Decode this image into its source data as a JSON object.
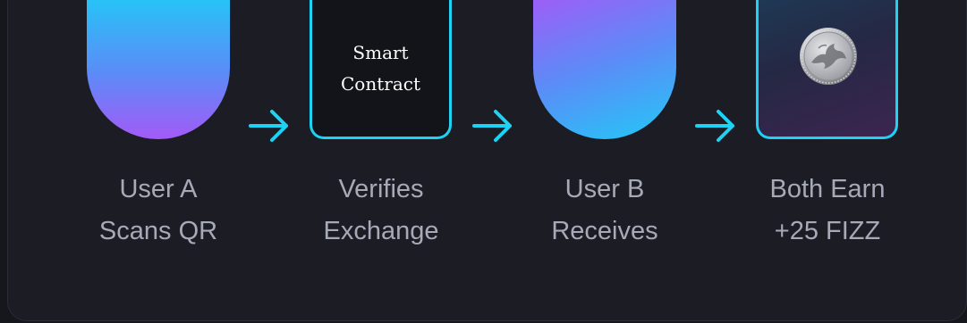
{
  "steps": [
    {
      "id": "user-a",
      "label_lines": [
        "User A",
        "Scans QR"
      ]
    },
    {
      "id": "contract",
      "box_lines": [
        "Smart",
        "Contract"
      ],
      "label_lines": [
        "Verifies",
        "Exchange"
      ]
    },
    {
      "id": "user-b",
      "label_lines": [
        "User B",
        "Receives"
      ]
    },
    {
      "id": "reward",
      "label_lines": [
        "Both Earn",
        "+25 FIZZ"
      ]
    }
  ],
  "icons": {
    "arrow": "arrow-right-icon",
    "reward": "fizz-coin-icon"
  },
  "colors": {
    "accent": "#1ed2f4",
    "gradient_cyan": "#22c9f7",
    "gradient_purple": "#a35af7",
    "label": "#a6a9b7",
    "panel": "#1b1c24"
  }
}
